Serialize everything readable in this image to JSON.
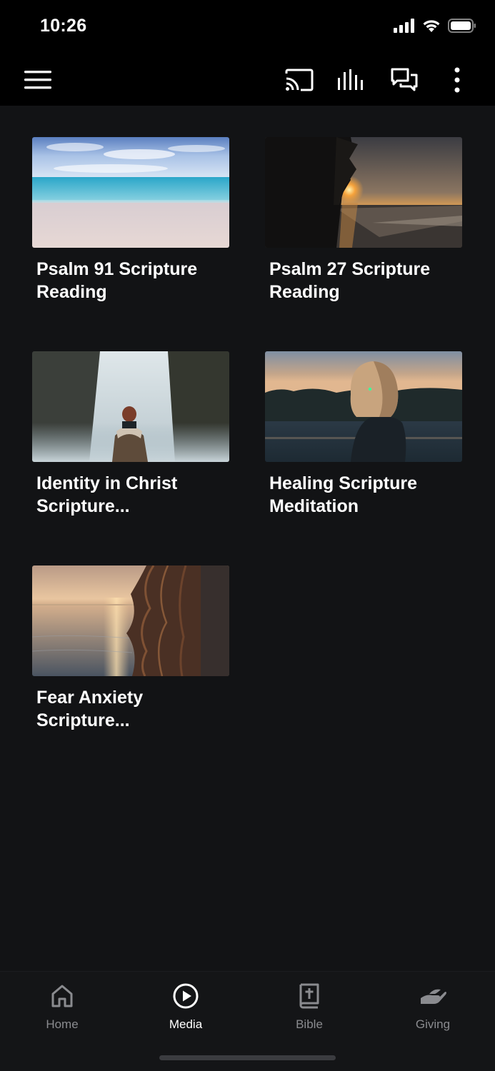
{
  "status_bar": {
    "time": "10:26"
  },
  "app_bar": {
    "icons": [
      "menu-icon",
      "cast-icon",
      "audio-bars-icon",
      "chat-icon",
      "more-vertical-icon"
    ]
  },
  "media": {
    "items": [
      {
        "title": "Psalm 91 Scripture Reading",
        "thumbnail": "ocean beach under blue sky"
      },
      {
        "title": "Psalm 27 Scripture Reading",
        "thumbnail": "sunset over shoreline with trees"
      },
      {
        "title": "Identity in Christ Scripture...",
        "thumbnail": "person facing waterfall"
      },
      {
        "title": "Healing Scripture Meditation",
        "thumbnail": "woman by lake at dusk"
      },
      {
        "title": "Fear Anxiety Scripture...",
        "thumbnail": "woman's hair against sea sunset"
      }
    ]
  },
  "bottom_nav": {
    "items": [
      {
        "label": "Home",
        "icon": "home-icon",
        "active": false
      },
      {
        "label": "Media",
        "icon": "play-circle-icon",
        "active": true
      },
      {
        "label": "Bible",
        "icon": "bible-icon",
        "active": false
      },
      {
        "label": "Giving",
        "icon": "giving-hand-icon",
        "active": false
      }
    ]
  },
  "colors": {
    "background": "#121315",
    "app_bar": "#000000",
    "active_nav": "#ffffff",
    "inactive_nav": "#8a8b8f"
  }
}
